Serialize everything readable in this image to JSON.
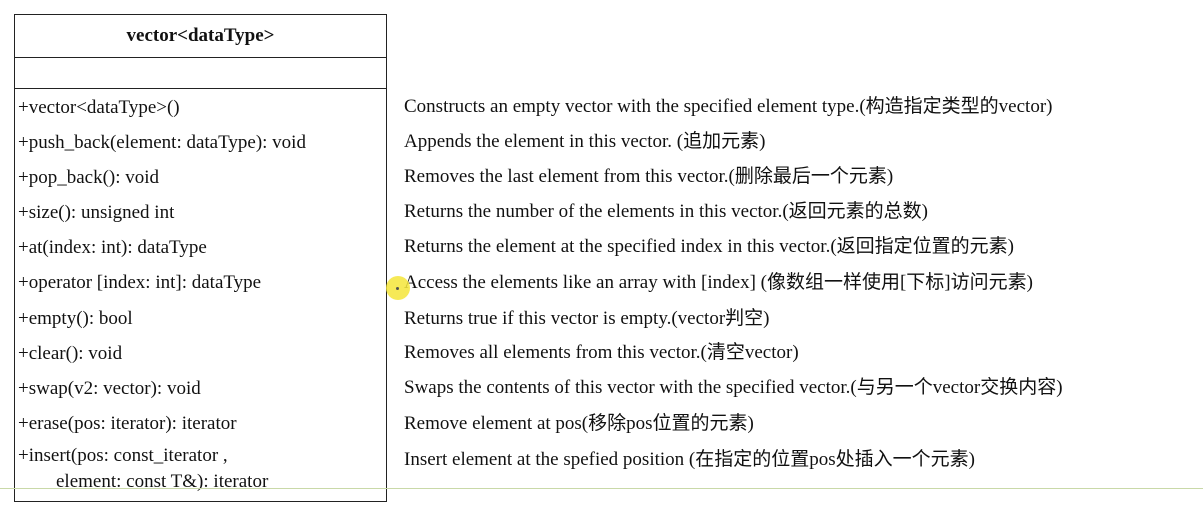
{
  "class_box": {
    "title": "vector<dataType>",
    "methods": [
      "+vector<dataType>()",
      "+push_back(element: dataType): void",
      "+pop_back(): void",
      "+size(): unsigned int",
      "+at(index: int): dataType",
      "+operator [index: int]: dataType",
      "+empty(): bool",
      "+clear(): void",
      "+swap(v2: vector): void",
      "+erase(pos: iterator): iterator",
      "+insert(pos: const_iterator ,",
      "        element: const T&): iterator"
    ]
  },
  "descriptions": [
    "Constructs an empty vector with the specified element type.(构造指定类型的vector)",
    "Appends the element in this vector. (追加元素)",
    "Removes the last element from this vector.(删除最后一个元素)",
    "Returns the number of the elements in this vector.(返回元素的总数)",
    "Returns the element at the specified index in this vector.(返回指定位置的元素)",
    "Access the elements like an array with [index] (像数组一样使用[下标]访问元素)",
    "Returns true if this vector is empty.(vector判空)",
    "Removes all elements from this vector.(清空vector)",
    "Swaps the contents of this vector with the specified vector.(与另一个vector交换内容)",
    "Remove element at pos(移除pos位置的元素)",
    "Insert element at the spefied position (在指定的位置pos处插入一个元素)"
  ],
  "colors": {
    "border": "#222222",
    "cursor_highlight": "#f5e63a",
    "bottom_rule": "#c9d9a8"
  }
}
